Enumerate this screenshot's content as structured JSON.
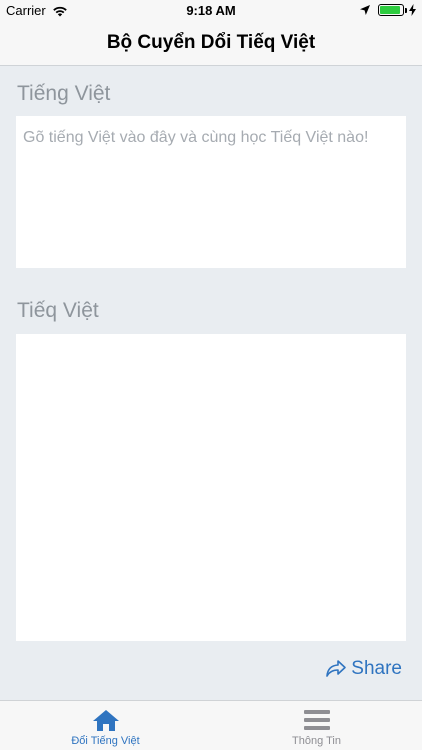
{
  "status_bar": {
    "carrier": "Carrier",
    "time": "9:18 AM",
    "battery_level": 0.9
  },
  "nav": {
    "title": "Bộ Cuyển Dổi Tiếq Việt"
  },
  "input_section": {
    "label": "Tiếng Việt",
    "placeholder": "Gõ tiếng Việt vào đây và cùng học Tiếq Việt nào!",
    "value": ""
  },
  "output_section": {
    "label": "Tiếq Việt",
    "value": ""
  },
  "share": {
    "label": "Share"
  },
  "tabs": [
    {
      "label": "Đổi Tiếng Việt",
      "icon": "home-icon",
      "active": true
    },
    {
      "label": "Thông Tin",
      "icon": "menu-icon",
      "active": false
    }
  ],
  "colors": {
    "accent": "#2f74c0",
    "background": "#e9edf1",
    "label": "#8e959c"
  }
}
